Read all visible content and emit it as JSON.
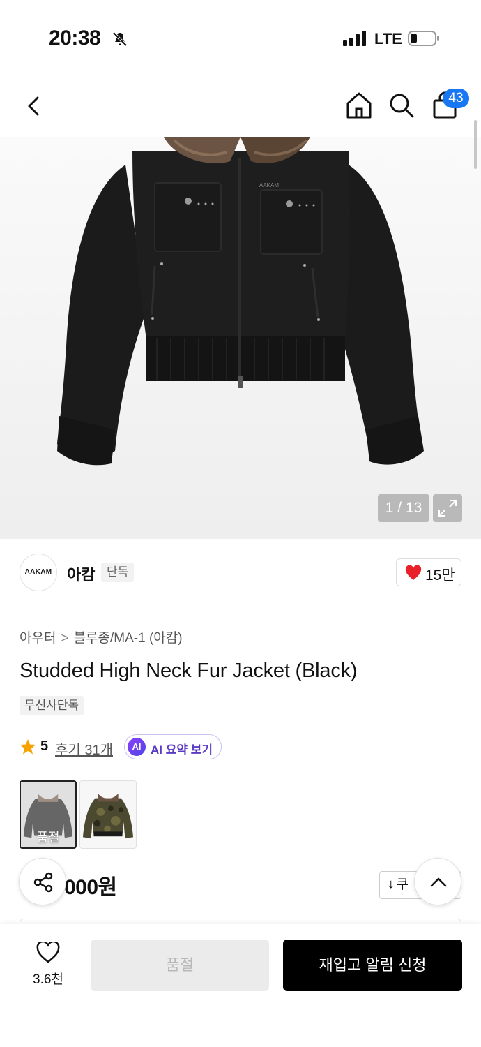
{
  "status_bar": {
    "time": "20:38",
    "network": "LTE",
    "icons": [
      "bell-slash-icon",
      "signal-icon",
      "battery-icon"
    ]
  },
  "nav": {
    "icons": [
      "back-icon",
      "home-icon",
      "search-icon",
      "cart-icon"
    ],
    "cart_badge": "43",
    "badge_color": "#1877f2"
  },
  "gallery": {
    "counter": "1 / 13",
    "brand_print": "AAKAM",
    "icons": [
      "expand-icon"
    ]
  },
  "brand": {
    "logo_text": "AAKAM",
    "name": "아캄",
    "tag": "단독",
    "like_count": "15만",
    "like_color": "#e8202a"
  },
  "product": {
    "breadcrumb": [
      "아우터",
      "블루종/MA-1 (아캄)"
    ],
    "title": "Studded High Neck Fur Jacket (Black)",
    "exclusive_tag": "무신사단독",
    "rating": "5",
    "review_label": "후기 31개",
    "ai_icon_label": "AI",
    "ai_button_label": "AI 요약 보기",
    "options": [
      {
        "name": "black",
        "soldout_label": "품절",
        "selected": true
      },
      {
        "name": "camo",
        "soldout_label": "",
        "selected": false
      }
    ],
    "price_visible": "000원",
    "coupon_label": "쿠"
  },
  "bottom_bar": {
    "wish_count": "3.6천",
    "soldout_label": "품절",
    "restock_label": "재입고 알림 신청"
  }
}
